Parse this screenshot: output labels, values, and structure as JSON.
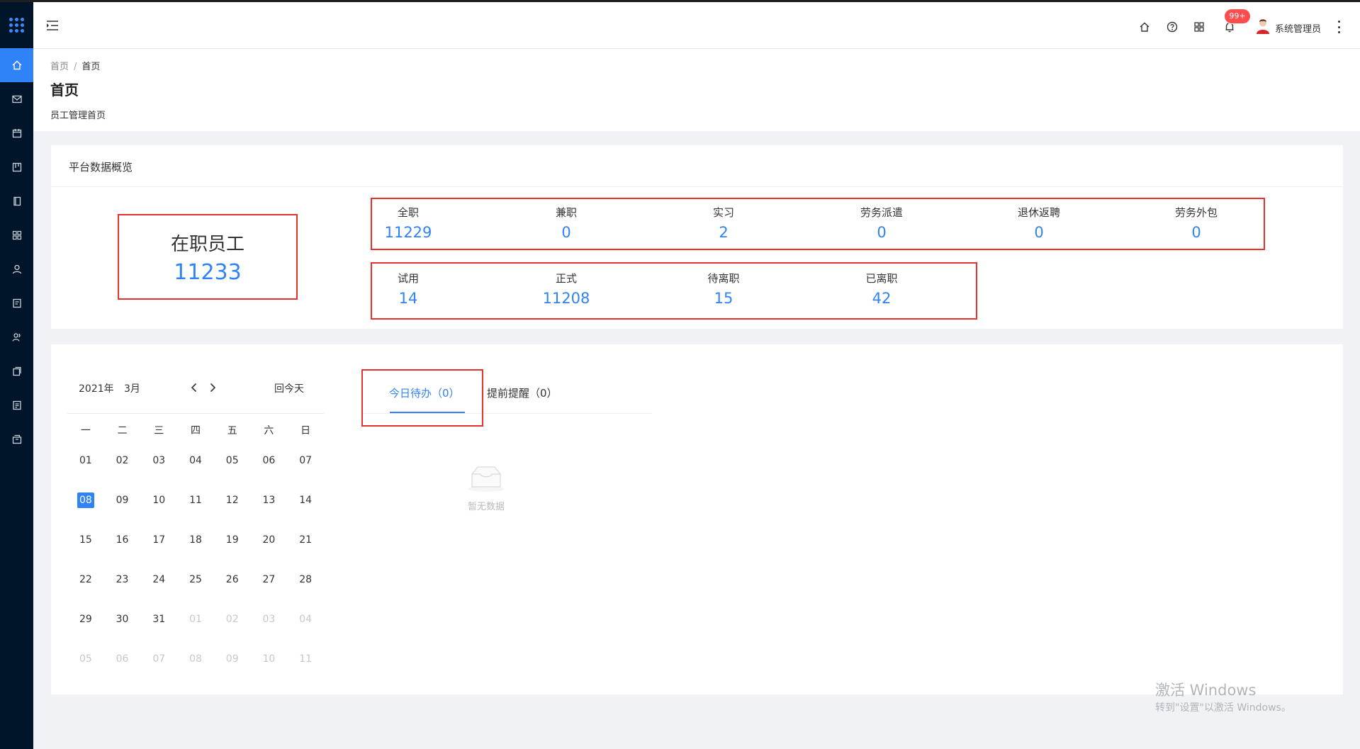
{
  "header": {
    "user_name": "系统管理员",
    "notification_badge": "99+",
    "icons": [
      "home-icon",
      "help-icon",
      "apps-icon",
      "bell-icon"
    ]
  },
  "sidebar": {
    "items": [
      "home-icon",
      "mail-icon",
      "calendar-icon",
      "board-icon",
      "book-icon",
      "apps-icon",
      "user-icon",
      "document-icon",
      "users-icon",
      "copy-icon",
      "report-icon",
      "archive-icon"
    ],
    "accent": "#2f83f7",
    "bg": "#001529"
  },
  "breadcrumb": {
    "root": "首页",
    "sep": "/",
    "current": "首页"
  },
  "page": {
    "title": "首页",
    "subtitle": "员工管理首页"
  },
  "overview": {
    "title": "平台数据概览",
    "active_employees": {
      "label": "在职员工",
      "value": "11233"
    },
    "types": [
      {
        "label": "全职",
        "value": "11229"
      },
      {
        "label": "兼职",
        "value": "0"
      },
      {
        "label": "实习",
        "value": "2"
      },
      {
        "label": "劳务派遣",
        "value": "0"
      },
      {
        "label": "退休返聘",
        "value": "0"
      },
      {
        "label": "劳务外包",
        "value": "0"
      }
    ],
    "statuses": [
      {
        "label": "试用",
        "value": "14"
      },
      {
        "label": "正式",
        "value": "11208"
      },
      {
        "label": "待离职",
        "value": "15"
      },
      {
        "label": "已离职",
        "value": "42"
      }
    ]
  },
  "calendar": {
    "year": "2021年",
    "month": "3月",
    "today_button": "回今天",
    "weekdays": [
      "一",
      "二",
      "三",
      "四",
      "五",
      "六",
      "日"
    ],
    "weeks": [
      [
        "01",
        "02",
        "03",
        "04",
        "05",
        "06",
        "07"
      ],
      [
        "08",
        "09",
        "10",
        "11",
        "12",
        "13",
        "14"
      ],
      [
        "15",
        "16",
        "17",
        "18",
        "19",
        "20",
        "21"
      ],
      [
        "22",
        "23",
        "24",
        "25",
        "26",
        "27",
        "28"
      ],
      [
        "29",
        "30",
        "31",
        "01",
        "02",
        "03",
        "04"
      ],
      [
        "05",
        "06",
        "07",
        "08",
        "09",
        "10",
        "11"
      ]
    ],
    "selected": "08"
  },
  "tasks": {
    "tab_today": "今日待办（0）",
    "tab_remind": "提前提醒（0）",
    "empty_text": "暂无数据"
  },
  "watermark": {
    "line1": "激活 Windows",
    "line2": "转到\"设置\"以激活 Windows。"
  }
}
